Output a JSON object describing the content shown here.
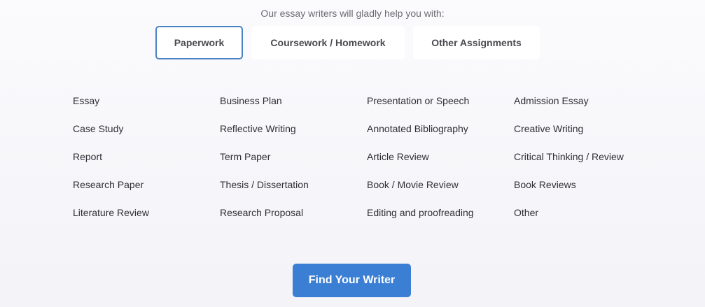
{
  "intro": "Our essay writers will gladly help you with:",
  "tabs": [
    {
      "label": "Paperwork",
      "active": true
    },
    {
      "label": "Coursework / Homework",
      "active": false
    },
    {
      "label": "Other Assignments",
      "active": false
    }
  ],
  "services": [
    [
      "Essay",
      "Case Study",
      "Report",
      "Research Paper",
      "Literature Review"
    ],
    [
      "Business Plan",
      "Reflective Writing",
      "Term Paper",
      "Thesis / Dissertation",
      "Research Proposal"
    ],
    [
      "Presentation or Speech",
      "Annotated Bibliography",
      "Article Review",
      "Book / Movie Review",
      "Editing and proofreading"
    ],
    [
      "Admission Essay",
      "Creative Writing",
      "Critical Thinking / Review",
      "Book Reviews",
      "Other"
    ]
  ],
  "cta_label": "Find Your Writer",
  "colors": {
    "accent": "#3b7fd4",
    "active_tab_border": "#4a82c2",
    "text": "#2f2f35",
    "muted_text": "#6b6b72"
  }
}
